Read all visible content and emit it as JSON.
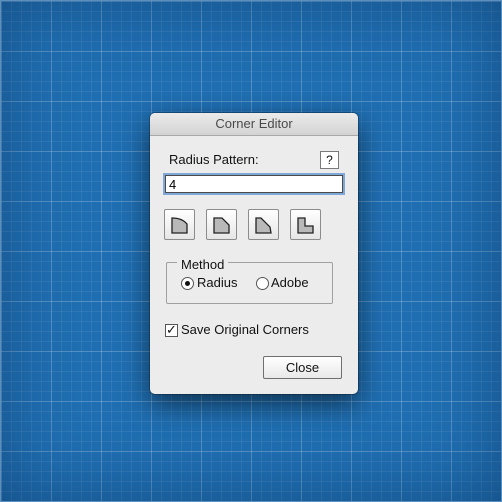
{
  "dialog": {
    "title": "Corner Editor",
    "radius_label": "Radius Pattern:",
    "help_label": "?",
    "radius_value": "4",
    "corner_buttons": [
      {
        "icon": "round-corner-icon"
      },
      {
        "icon": "bevel-corner-icon"
      },
      {
        "icon": "inset-bevel-corner-icon"
      },
      {
        "icon": "notch-corner-icon"
      }
    ],
    "method": {
      "legend": "Method",
      "options": [
        {
          "label": "Radius",
          "selected": true
        },
        {
          "label": "Adobe",
          "selected": false
        }
      ]
    },
    "save_original": {
      "label": "Save Original Corners",
      "checked": true,
      "mark": "✓"
    },
    "close_label": "Close"
  },
  "colors": {
    "background": "#1f6eb1",
    "dialog": "#ececec",
    "focus_ring": "#7fa7d8"
  }
}
